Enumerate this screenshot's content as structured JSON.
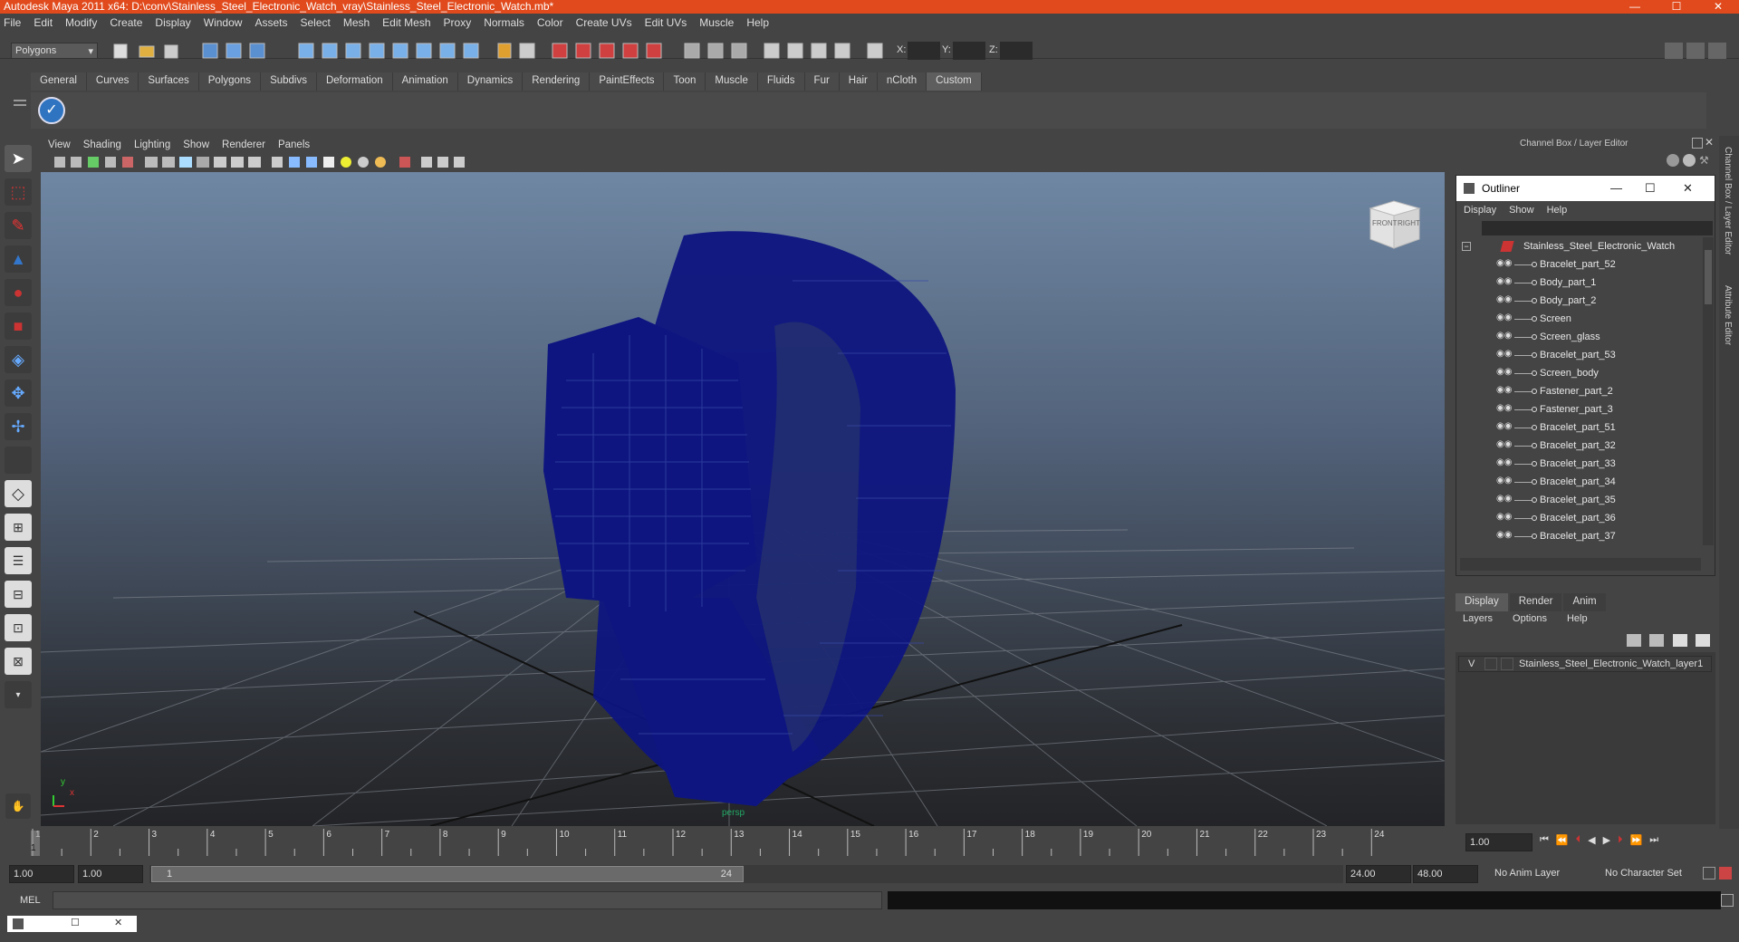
{
  "window": {
    "title": "Autodesk Maya 2011 x64: D:\\conv\\Stainless_Steel_Electronic_Watch_vray\\Stainless_Steel_Electronic_Watch.mb*",
    "minimize": "—",
    "maximize": "☐",
    "close": "✕"
  },
  "menu": [
    "File",
    "Edit",
    "Modify",
    "Create",
    "Display",
    "Window",
    "Assets",
    "Select",
    "Mesh",
    "Edit Mesh",
    "Proxy",
    "Normals",
    "Color",
    "Create UVs",
    "Edit UVs",
    "Muscle",
    "Help"
  ],
  "status": {
    "mode": "Polygons",
    "x_label": "X:",
    "y_label": "Y:",
    "z_label": "Z:"
  },
  "shelf": {
    "tabs": [
      "General",
      "Curves",
      "Surfaces",
      "Polygons",
      "Subdivs",
      "Deformation",
      "Animation",
      "Dynamics",
      "Rendering",
      "PaintEffects",
      "Toon",
      "Muscle",
      "Fluids",
      "Fur",
      "Hair",
      "nCloth",
      "Custom"
    ],
    "active": "Custom"
  },
  "viewport": {
    "menu": [
      "View",
      "Shading",
      "Lighting",
      "Show",
      "Renderer",
      "Panels"
    ],
    "cube_front": "FRONT",
    "cube_right": "RIGHT",
    "axis_y": "y",
    "axis_x": "x",
    "camera": "persp",
    "wire_color": "#0e1580"
  },
  "channel_box": {
    "title": "Channel Box / Layer Editor",
    "side_tab_1": "Channel Box / Layer Editor",
    "side_tab_2": "Attribute Editor"
  },
  "outliner": {
    "title": "Outliner",
    "menu": [
      "Display",
      "Show",
      "Help"
    ],
    "root": "Stainless_Steel_Electronic_Watch",
    "items": [
      "Bracelet_part_52",
      "Body_part_1",
      "Body_part_2",
      "Screen",
      "Screen_glass",
      "Bracelet_part_53",
      "Screen_body",
      "Fastener_part_2",
      "Fastener_part_3",
      "Bracelet_part_51",
      "Bracelet_part_32",
      "Bracelet_part_33",
      "Bracelet_part_34",
      "Bracelet_part_35",
      "Bracelet_part_36",
      "Bracelet_part_37"
    ]
  },
  "layer_editor": {
    "tabs": [
      "Display",
      "Render",
      "Anim"
    ],
    "active": "Display",
    "menu": [
      "Layers",
      "Options",
      "Help"
    ],
    "layer_visible": "V",
    "layer_name": "Stainless_Steel_Electronic_Watch_layer1"
  },
  "timeline": {
    "ticks": [
      "1",
      "2",
      "3",
      "4",
      "5",
      "6",
      "7",
      "8",
      "9",
      "10",
      "11",
      "12",
      "13",
      "14",
      "15",
      "16",
      "17",
      "18",
      "19",
      "20",
      "21",
      "22",
      "23",
      "24"
    ],
    "current_frame": "1",
    "frame_field": "1.00"
  },
  "range": {
    "start": "1.00",
    "playback_start": "1.00",
    "slider_start": "1",
    "slider_end": "24",
    "playback_end": "24.00",
    "end": "48.00",
    "anim_layer": "No Anim Layer",
    "character_set": "No Character Set"
  },
  "command": {
    "lang": "MEL"
  }
}
